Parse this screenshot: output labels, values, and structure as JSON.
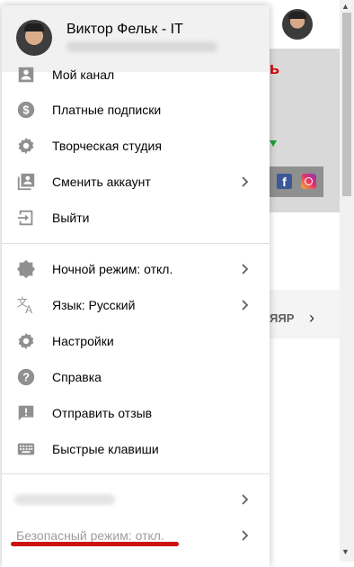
{
  "background": {
    "popular_label": "ЯЯР",
    "facebook_letter": "f",
    "colors": {
      "banner": "#d9d9d9",
      "accent_red": "#d60000",
      "green_mark": "#1b9e2e",
      "facebook": "#3b5998"
    }
  },
  "account": {
    "name": "Виктор Фельк - IT",
    "avatar_icon": "user-avatar"
  },
  "menu": {
    "group1": [
      {
        "label": "Мой канал",
        "icon": "person-icon"
      },
      {
        "label": "Платные подписки",
        "icon": "dollar-icon"
      },
      {
        "label": "Творческая студия",
        "icon": "gear-icon"
      },
      {
        "label": "Сменить аккаунт",
        "icon": "switch-account-icon",
        "has_submenu": true
      },
      {
        "label": "Выйти",
        "icon": "logout-icon"
      }
    ],
    "group2": [
      {
        "label": "Ночной режим: откл.",
        "icon": "night-mode-icon",
        "has_submenu": true
      },
      {
        "label": "Язык: Русский",
        "icon": "translate-icon",
        "has_submenu": true
      },
      {
        "label": "Настройки",
        "icon": "gear-icon"
      },
      {
        "label": "Справка",
        "icon": "help-icon"
      },
      {
        "label": "Отправить отзыв",
        "icon": "feedback-icon"
      },
      {
        "label": "Быстрые клавиши",
        "icon": "keyboard-icon"
      }
    ],
    "group3": [
      {
        "label": "",
        "has_submenu": true
      },
      {
        "label": "Безопасный режим: откл.",
        "has_submenu": true
      }
    ]
  },
  "colors": {
    "icon": "#909090",
    "text": "#030303",
    "highlight_red": "#cc1111",
    "header_bg": "#f1f1f1"
  }
}
